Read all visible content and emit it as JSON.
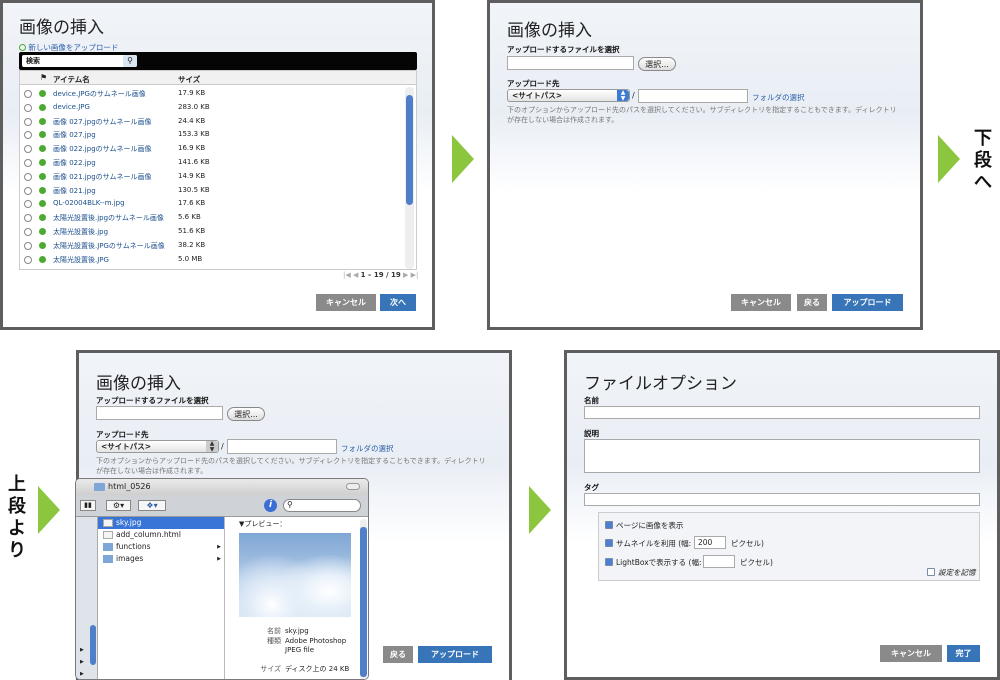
{
  "panel1": {
    "title": "画像の挿入",
    "upload_link": "新しい画像をアップロード",
    "search_placeholder": "検索",
    "col_name": "アイテム名",
    "col_size": "サイズ",
    "files": [
      {
        "name": "device.JPGのサムネール画像",
        "size": "17.9 KB"
      },
      {
        "name": "device.JPG",
        "size": "283.0 KB"
      },
      {
        "name": "画像 027.jpgのサムネール画像",
        "size": "24.4 KB"
      },
      {
        "name": "画像 027.jpg",
        "size": "153.3 KB"
      },
      {
        "name": "画像 022.jpgのサムネール画像",
        "size": "16.9 KB"
      },
      {
        "name": "画像 022.jpg",
        "size": "141.6 KB"
      },
      {
        "name": "画像 021.jpgのサムネール画像",
        "size": "14.9 KB"
      },
      {
        "name": "画像 021.jpg",
        "size": "130.5 KB"
      },
      {
        "name": "QL-02004BLK--m.jpg",
        "size": "17.6 KB"
      },
      {
        "name": "太陽光設置後.jpgのサムネール画像",
        "size": "5.6 KB"
      },
      {
        "name": "太陽光設置後.jpg",
        "size": "51.6 KB"
      },
      {
        "name": "太陽光設置後.JPGのサムネール画像",
        "size": "38.2 KB"
      },
      {
        "name": "太陽光設置後.JPG",
        "size": "5.0 MB"
      }
    ],
    "pagination": "1 – 19 / 19",
    "cancel": "キャンセル",
    "next": "次へ"
  },
  "panel2": {
    "title": "画像の挿入",
    "file_label": "アップロードするファイルを選択",
    "choose": "選択...",
    "dest_label": "アップロード先",
    "site_path": "<サイトパス>",
    "slash": "/",
    "folder_link": "フォルダの選択",
    "note": "下のオプションからアップロード先のパスを選択してください。サブディレクトリを指定することもできます。ディレクトリが存在しない場合は作成されます。",
    "cancel": "キャンセル",
    "back": "戻る",
    "upload": "アップロード"
  },
  "to_lower": "下段へ",
  "from_upper": "上段より",
  "panel3": {
    "title": "画像の挿入",
    "file_label": "アップロードするファイルを選択",
    "choose": "選択...",
    "dest_label": "アップロード先",
    "site_path": "<サイトパス>",
    "slash": "/",
    "folder_link": "フォルダの選択",
    "note": "下のオプションからアップロード先のパスを選択してください。サブディレクトリを指定することもできます。ディレクトリが存在しない場合は作成されます。",
    "back": "戻る",
    "upload": "アップロード",
    "finder": {
      "path": "html_0526",
      "items": [
        {
          "name": "sky.jpg",
          "selected": true,
          "folder": false
        },
        {
          "name": "add_column.html",
          "selected": false,
          "folder": false
        },
        {
          "name": "functions",
          "selected": false,
          "folder": true
        },
        {
          "name": "images",
          "selected": false,
          "folder": true
        }
      ],
      "preview_label": "▼プレビュー：",
      "meta_name_key": "名前",
      "meta_name_val": "sky.jpg",
      "meta_kind_key": "種類",
      "meta_kind_val": "Adobe Photoshop JPEG file",
      "meta_size_key": "サイズ",
      "meta_size_val": "ディスク上の 24 KB"
    }
  },
  "panel4": {
    "title": "ファイルオプション",
    "name_label": "名前",
    "desc_label": "説明",
    "tag_label": "タグ",
    "opt_show": "ページに画像を表示",
    "opt_thumb": "サムネイルを利用 (幅:",
    "thumb_width": "200",
    "px1": "ピクセル)",
    "opt_lightbox": "LightBoxで表示する (幅:",
    "px2": "ピクセル)",
    "remember": "設定を記憶",
    "cancel": "キャンセル",
    "done": "完了"
  }
}
